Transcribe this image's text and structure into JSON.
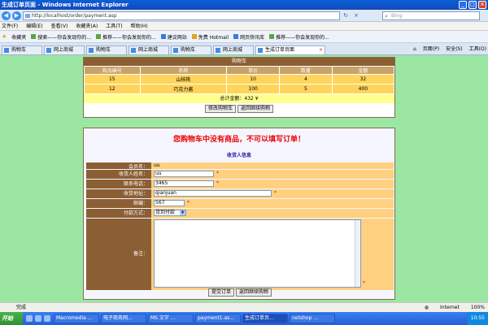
{
  "window": {
    "title": "生成订单页面 - Windows Internet Explorer",
    "minimize": "_",
    "maximize": "□",
    "close": "×"
  },
  "address": {
    "url": "http://localhost/order/payment.asp",
    "search_placeholder": "Bing",
    "back": "◀",
    "forward": "▶",
    "refresh": "↻",
    "stop": "×"
  },
  "menu": [
    "文件(F)",
    "编辑(E)",
    "查看(V)",
    "收藏夹(A)",
    "工具(T)",
    "帮助(H)"
  ],
  "favorites": {
    "label": "收藏夹",
    "items": [
      {
        "label": "搜索——你会发现你的...",
        "icon": "bookmark-icon"
      },
      {
        "label": "推荐——你会发现你的...",
        "icon": "bookmark-icon"
      },
      {
        "label": "建议网站",
        "icon": "bookmark-icon"
      },
      {
        "label": "免费 Hotmail",
        "icon": "bookmark-icon"
      },
      {
        "label": "网页快讯库",
        "icon": "bookmark-icon"
      },
      {
        "label": "推荐——你会发现你的...",
        "icon": "bookmark-icon"
      }
    ]
  },
  "tabs": [
    {
      "label": "购物车",
      "active": false
    },
    {
      "label": "网上商城",
      "active": false
    },
    {
      "label": "购物车",
      "active": false
    },
    {
      "label": "网上商城",
      "active": false
    },
    {
      "label": "购物车",
      "active": false
    },
    {
      "label": "网上商城",
      "active": false
    },
    {
      "label": "生成订单页面",
      "active": true
    }
  ],
  "tab_tools": [
    "页面(P)",
    "安全(S)",
    "工具(O)"
  ],
  "cart": {
    "title": "购物车",
    "columns": [
      "商品编号",
      "名称",
      "单价",
      "数量",
      "金额"
    ],
    "rows": [
      [
        "15",
        "山核桃",
        "10",
        "4",
        "32"
      ],
      [
        "12",
        "巧克力酱",
        "100",
        "5",
        "400"
      ]
    ],
    "total": "总计金额：432 ¥",
    "modify_button": "修改购物车",
    "continue_button": "返回继续购物"
  },
  "order": {
    "error_message": "您购物车中没有商品，不可以填写订单！",
    "section_title": "收货人信息",
    "fields": {
      "member_label": "会员名：",
      "member_value": "uu",
      "name_label": "收货人姓名：",
      "name_value": "uu",
      "phone_label": "联系电话：",
      "phone_value": "3465",
      "address_label": "收货地址：",
      "address_value": "qianjuan",
      "zip_label": "邮编：",
      "zip_value": "567",
      "payment_label": "付款方式：",
      "payment_value": "货到付款",
      "notes_label": "备注：",
      "required_mark": "*"
    },
    "submit_button": "提交订单",
    "continue_button": "返回继续购物"
  },
  "status": {
    "text": "完成",
    "zone": "Internet",
    "zoom": "100%"
  },
  "taskbar": {
    "start": "开始",
    "tasks": [
      "Macromedia ...",
      "电子商务网...",
      "MS 文字 ...",
      "payment1.as...",
      "生成订单页...",
      "netshop ..."
    ],
    "active_task": 4,
    "clock": "10:55"
  }
}
